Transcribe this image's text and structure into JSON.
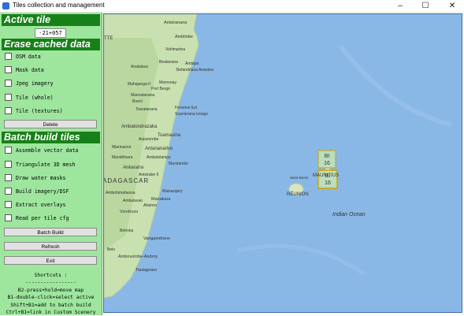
{
  "window": {
    "title": "Tiles collection and management",
    "minimize": "–",
    "maximize": "☐",
    "close": "✕"
  },
  "panel": {
    "active_tile_header": "Active tile",
    "active_tile_value": "-21+057",
    "erase_header": "Erase cached data",
    "erase_items": [
      "OSM data",
      "Mask data",
      "Jpeg imagery",
      "Tile (whole)",
      "Tile (textures)"
    ],
    "delete_label": "Delete",
    "batch_header": "Batch build tiles",
    "batch_items": [
      "Assemble vector data",
      "Triangulate 3D mesh",
      "Draw water masks",
      "Build imagery/DSF",
      "Extract overlays",
      "Read per tile cfg"
    ],
    "batch_build_label": "Batch Build",
    "refresh_label": "Refresh",
    "exit_label": "Exit",
    "shortcuts_title": "Shortcuts :",
    "shortcuts_rule": "-----------------",
    "shortcuts_lines": [
      "B2-press+hold=move map",
      "B1-double-click=select active",
      "Shift+B1=add to batch build",
      "Ctrl+B1=link in Custom Scenery"
    ]
  },
  "map": {
    "ocean_label": "Indian Ocean",
    "reunion_label": "RÉUNION",
    "mauritius_label": "MAURITIUS",
    "saint_denis_label": "Saint-Denis",
    "madagascar_label": "ADAGASCAR",
    "ankaratra_label": "Ankaratra",
    "partial_top_label": "TTE",
    "tile_markers": [
      {
        "line1": "BI",
        "line2": "16"
      },
      {
        "line1": "BI",
        "line2": "16"
      }
    ],
    "cities": [
      "Antsiranana",
      "Ambilobe",
      "Vohimarina",
      "Bealanana",
      "Andapa",
      "Befandriana Avaratra",
      "Analalava",
      "Mahajanga II",
      "Marovoay",
      "Port Bergé",
      "Mandritsara",
      "Maevatanana",
      "Boeni",
      "Fenerive Est",
      "Soanierana Ivongo",
      "Tsaratanana",
      "Ambatondrazaka",
      "Toamasina",
      "Anjozorobe",
      "Miarinarivo",
      "Antananarivo",
      "Mandritsara",
      "Ambatolampy",
      "Antsirabe II",
      "Marolambo",
      "Ambohimahasoa",
      "Mananjary",
      "Ambalavao",
      "Manakara",
      "Atsimo",
      "Vondrozo",
      "Betroka",
      "Vangaindrano",
      "Ambovombe-Androy",
      "Taolagnaro",
      "Belo"
    ],
    "colors": {
      "ocean": "#8ab8e6",
      "land": "#c9e0b0",
      "tile_fill": "#c8e6b4",
      "tile_border": "#c9a300"
    }
  }
}
